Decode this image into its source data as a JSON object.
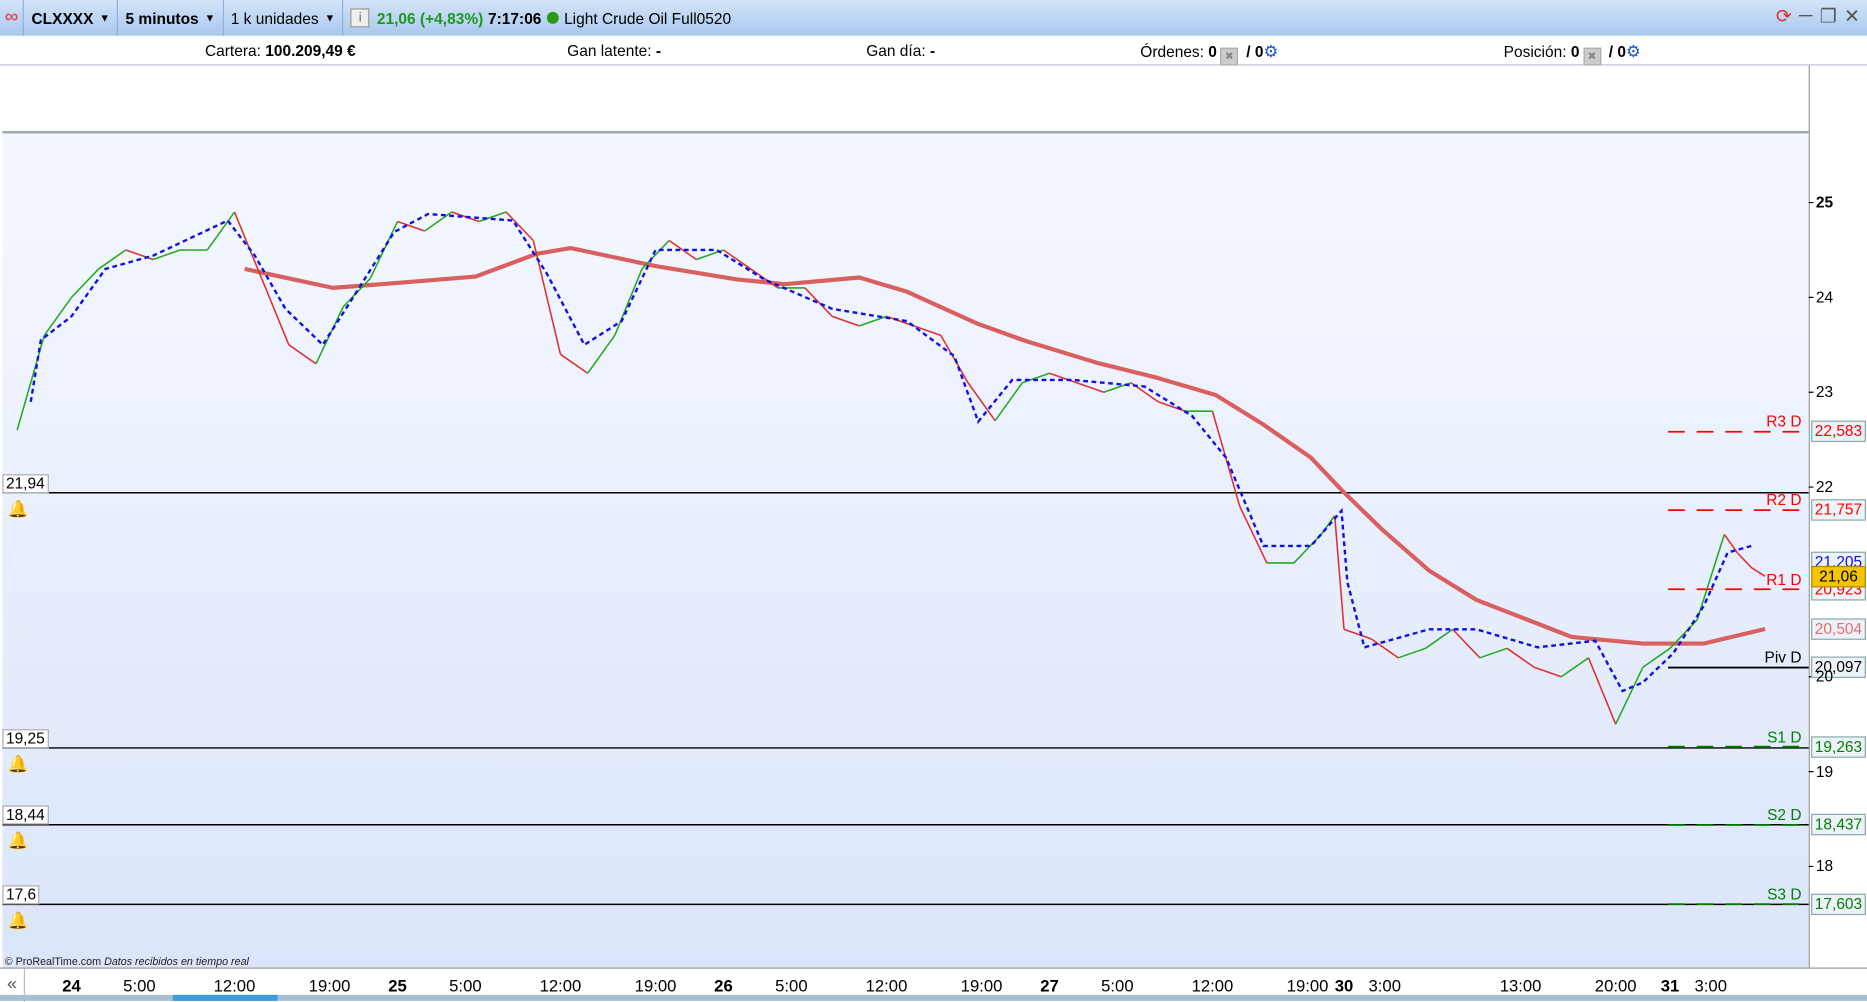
{
  "titlebar": {
    "symbol": "CLXXXX",
    "timeframe": "5 minutos",
    "units": "1 k unidades",
    "price_change": "21,06 (+4,83%)",
    "time": "7:17:06",
    "instrument": "Light Crude Oil Full0520",
    "icons": [
      "link-icon",
      "info-icon",
      "status-dot-icon",
      "refresh-icon",
      "minimize-icon",
      "restore-icon",
      "close-icon"
    ]
  },
  "infobar": {
    "cartera_label": "Cartera:",
    "cartera_value": "100.209,49 €",
    "gan_latente_label": "Gan latente:",
    "gan_latente_value": "-",
    "gan_dia_label": "Gan día:",
    "gan_dia_value": "-",
    "ordenes_label": "Órdenes:",
    "ordenes_value": "0",
    "ordenes_slash": "/ 0",
    "posicion_label": "Posición:",
    "posicion_value": "0",
    "posicion_slash": "/ 0"
  },
  "footer": {
    "copyright": "© ProRealTime.com",
    "status": "Datos recibidos en tiempo real"
  },
  "colors": {
    "up": "#22aa22",
    "down": "#e03030",
    "ma": "#d9605e",
    "kijun": "#1010e0",
    "resistance": "#ff0000",
    "support": "#008000",
    "current": "#f5c400"
  },
  "chart_data": {
    "type": "line",
    "title": "",
    "ylim": [
      17.2,
      25.8
    ],
    "y_ticks": [
      "25",
      "24",
      "23",
      "22",
      "20",
      "19",
      "18"
    ],
    "y_tick_values": [
      25,
      24,
      23,
      22,
      20,
      19,
      18
    ],
    "x_ticks": [
      {
        "label": "24",
        "t": "24 00:00",
        "major": true
      },
      {
        "label": "5:00",
        "t": "24 05:00"
      },
      {
        "label": "12:00",
        "t": "24 12:00"
      },
      {
        "label": "19:00",
        "t": "24 19:00"
      },
      {
        "label": "25",
        "t": "25 00:00",
        "major": true
      },
      {
        "label": "5:00",
        "t": "25 05:00"
      },
      {
        "label": "12:00",
        "t": "25 12:00"
      },
      {
        "label": "19:00",
        "t": "25 19:00"
      },
      {
        "label": "26",
        "t": "26 00:00",
        "major": true
      },
      {
        "label": "5:00",
        "t": "26 05:00"
      },
      {
        "label": "12:00",
        "t": "26 12:00"
      },
      {
        "label": "19:00",
        "t": "26 19:00"
      },
      {
        "label": "27",
        "t": "27 00:00",
        "major": true
      },
      {
        "label": "5:00",
        "t": "27 05:00"
      },
      {
        "label": "12:00",
        "t": "27 12:00"
      },
      {
        "label": "19:00",
        "t": "27 19:00"
      },
      {
        "label": "30",
        "t": "30 00:00",
        "major": true
      },
      {
        "label": "3:00",
        "t": "30 03:00"
      },
      {
        "label": "13:00",
        "t": "30 13:00"
      },
      {
        "label": "20:00",
        "t": "30 20:00"
      },
      {
        "label": "31",
        "t": "31 00:00",
        "major": true
      },
      {
        "label": "3:00",
        "t": "31 03:00"
      }
    ],
    "series": [
      {
        "key": "price",
        "values": [
          [
            "23 20:00",
            22.6
          ],
          [
            "23 22:00",
            23.6
          ],
          [
            "24 00:00",
            24.0
          ],
          [
            "24 02:00",
            24.3
          ],
          [
            "24 04:00",
            24.5
          ],
          [
            "24 06:00",
            24.4
          ],
          [
            "24 08:00",
            24.5
          ],
          [
            "24 10:00",
            24.5
          ],
          [
            "24 12:00",
            24.9
          ],
          [
            "24 14:00",
            24.2
          ],
          [
            "24 16:00",
            23.5
          ],
          [
            "24 18:00",
            23.3
          ],
          [
            "24 20:00",
            23.9
          ],
          [
            "24 22:00",
            24.2
          ],
          [
            "25 00:00",
            24.8
          ],
          [
            "25 02:00",
            24.7
          ],
          [
            "25 04:00",
            24.9
          ],
          [
            "25 06:00",
            24.8
          ],
          [
            "25 08:00",
            24.9
          ],
          [
            "25 10:00",
            24.6
          ],
          [
            "25 12:00",
            23.4
          ],
          [
            "25 14:00",
            23.2
          ],
          [
            "25 16:00",
            23.6
          ],
          [
            "25 18:00",
            24.3
          ],
          [
            "25 20:00",
            24.6
          ],
          [
            "25 22:00",
            24.4
          ],
          [
            "26 00:00",
            24.5
          ],
          [
            "26 02:00",
            24.3
          ],
          [
            "26 04:00",
            24.1
          ],
          [
            "26 06:00",
            24.1
          ],
          [
            "26 08:00",
            23.8
          ],
          [
            "26 10:00",
            23.7
          ],
          [
            "26 12:00",
            23.8
          ],
          [
            "26 14:00",
            23.7
          ],
          [
            "26 16:00",
            23.6
          ],
          [
            "26 18:00",
            23.1
          ],
          [
            "26 20:00",
            22.7
          ],
          [
            "26 22:00",
            23.1
          ],
          [
            "27 00:00",
            23.2
          ],
          [
            "27 02:00",
            23.1
          ],
          [
            "27 04:00",
            23.0
          ],
          [
            "27 06:00",
            23.1
          ],
          [
            "27 08:00",
            22.9
          ],
          [
            "27 10:00",
            22.8
          ],
          [
            "27 12:00",
            22.8
          ],
          [
            "27 14:00",
            21.8
          ],
          [
            "27 16:00",
            21.2
          ],
          [
            "27 18:00",
            21.2
          ],
          [
            "27 20:00",
            21.5
          ],
          [
            "27 21:00",
            21.7
          ],
          [
            "30 00:00",
            20.5
          ],
          [
            "30 02:00",
            20.4
          ],
          [
            "30 04:00",
            20.2
          ],
          [
            "30 06:00",
            20.3
          ],
          [
            "30 08:00",
            20.5
          ],
          [
            "30 10:00",
            20.2
          ],
          [
            "30 12:00",
            20.3
          ],
          [
            "30 14:00",
            20.1
          ],
          [
            "30 16:00",
            20.0
          ],
          [
            "30 18:00",
            20.2
          ],
          [
            "30 20:00",
            19.5
          ],
          [
            "30 22:00",
            20.1
          ],
          [
            "31 00:00",
            20.3
          ],
          [
            "31 02:00",
            20.6
          ],
          [
            "31 04:00",
            21.5
          ],
          [
            "31 05:00",
            21.3
          ],
          [
            "31 06:00",
            21.15
          ],
          [
            "31 07:00",
            21.06
          ]
        ]
      },
      {
        "key": "moving-average",
        "values": [
          [
            "24 12:45",
            24.3
          ],
          [
            "24 19:15",
            24.1
          ],
          [
            "24 23:45",
            24.15
          ],
          [
            "25 05:45",
            24.22
          ],
          [
            "25 10:15",
            24.46
          ],
          [
            "25 12:45",
            24.52
          ],
          [
            "25 19:00",
            24.33
          ],
          [
            "26 01:00",
            24.19
          ],
          [
            "26 04:30",
            24.14
          ],
          [
            "26 10:00",
            24.21
          ],
          [
            "26 13:30",
            24.06
          ],
          [
            "26 18:45",
            23.72
          ],
          [
            "26 22:15",
            23.54
          ],
          [
            "27 03:30",
            23.31
          ],
          [
            "27 08:00",
            23.15
          ],
          [
            "27 12:15",
            22.97
          ],
          [
            "27 15:45",
            22.66
          ],
          [
            "27 19:15",
            22.31
          ],
          [
            "27 21:30",
            21.97
          ],
          [
            "30 02:45",
            21.56
          ],
          [
            "30 06:15",
            21.12
          ],
          [
            "30 09:45",
            20.81
          ],
          [
            "30 14:15",
            20.56
          ],
          [
            "30 16:45",
            20.42
          ],
          [
            "30 22:00",
            20.35
          ],
          [
            "31 02:30",
            20.35
          ],
          [
            "31 07:00",
            20.504
          ]
        ]
      },
      {
        "key": "kijun",
        "values": [
          [
            "23 21:00",
            22.9
          ],
          [
            "23 21:45",
            23.55
          ],
          [
            "24 00:00",
            23.8
          ],
          [
            "24 02:30",
            24.3
          ],
          [
            "24 06:00",
            24.44
          ],
          [
            "24 11:30",
            24.81
          ],
          [
            "24 13:30",
            24.44
          ],
          [
            "24 15:45",
            23.88
          ],
          [
            "24 18:30",
            23.5
          ],
          [
            "24 21:00",
            24.06
          ],
          [
            "24 23:45",
            24.69
          ],
          [
            "25 02:15",
            24.88
          ],
          [
            "25 08:30",
            24.81
          ],
          [
            "25 11:00",
            24.25
          ],
          [
            "25 13:45",
            23.5
          ],
          [
            "25 16:30",
            23.75
          ],
          [
            "25 19:00",
            24.5
          ],
          [
            "25 23:30",
            24.5
          ],
          [
            "26 03:00",
            24.19
          ],
          [
            "26 08:00",
            23.88
          ],
          [
            "26 13:30",
            23.75
          ],
          [
            "26 17:00",
            23.38
          ],
          [
            "26 18:45",
            22.69
          ],
          [
            "26 21:15",
            23.13
          ],
          [
            "27 01:45",
            23.13
          ],
          [
            "27 07:00",
            23.06
          ],
          [
            "27 10:30",
            22.75
          ],
          [
            "27 13:00",
            22.31
          ],
          [
            "27 15:45",
            21.38
          ],
          [
            "27 19:15",
            21.38
          ],
          [
            "27 21:30",
            21.75
          ],
          [
            "30 00:15",
            21.0
          ],
          [
            "30 01:30",
            20.31
          ],
          [
            "30 06:15",
            20.5
          ],
          [
            "30 09:45",
            20.5
          ],
          [
            "30 14:15",
            20.31
          ],
          [
            "30 18:30",
            20.38
          ],
          [
            "30 20:30",
            19.85
          ],
          [
            "30 22:00",
            19.94
          ],
          [
            "31 00:15",
            20.25
          ],
          [
            "31 02:30",
            20.75
          ],
          [
            "31 04:15",
            21.31
          ],
          [
            "31 06:00",
            21.38
          ]
        ]
      }
    ],
    "horizontal_lines": [
      {
        "label": "21,94",
        "value": 21.94
      },
      {
        "label": "19,25",
        "value": 19.25
      },
      {
        "label": "18,44",
        "value": 18.44
      },
      {
        "label": "17,6",
        "value": 17.6
      }
    ],
    "pivots": [
      {
        "name": "R3 D",
        "value": 22.583,
        "label": "22,583",
        "kind": "resistance"
      },
      {
        "name": "R2 D",
        "value": 21.757,
        "label": "21,757",
        "kind": "resistance"
      },
      {
        "name": "R1 D",
        "value": 20.923,
        "label": "20,923",
        "kind": "resistance"
      },
      {
        "name": "Piv D",
        "value": 20.097,
        "label": "20,097",
        "kind": "pivot"
      },
      {
        "name": "S1 D",
        "value": 19.263,
        "label": "19,263",
        "kind": "support"
      },
      {
        "name": "S2 D",
        "value": 18.437,
        "label": "18,437",
        "kind": "support"
      },
      {
        "name": "S3 D",
        "value": 17.603,
        "label": "17,603",
        "kind": "support"
      }
    ],
    "axis_markers": [
      {
        "label": "21,205",
        "value": 21.205,
        "color": "#1010e0"
      },
      {
        "label": "21,06",
        "value": 21.06,
        "color": "#000000",
        "current": true
      },
      {
        "label": "20,504",
        "value": 20.504,
        "color": "#e07070"
      }
    ]
  }
}
